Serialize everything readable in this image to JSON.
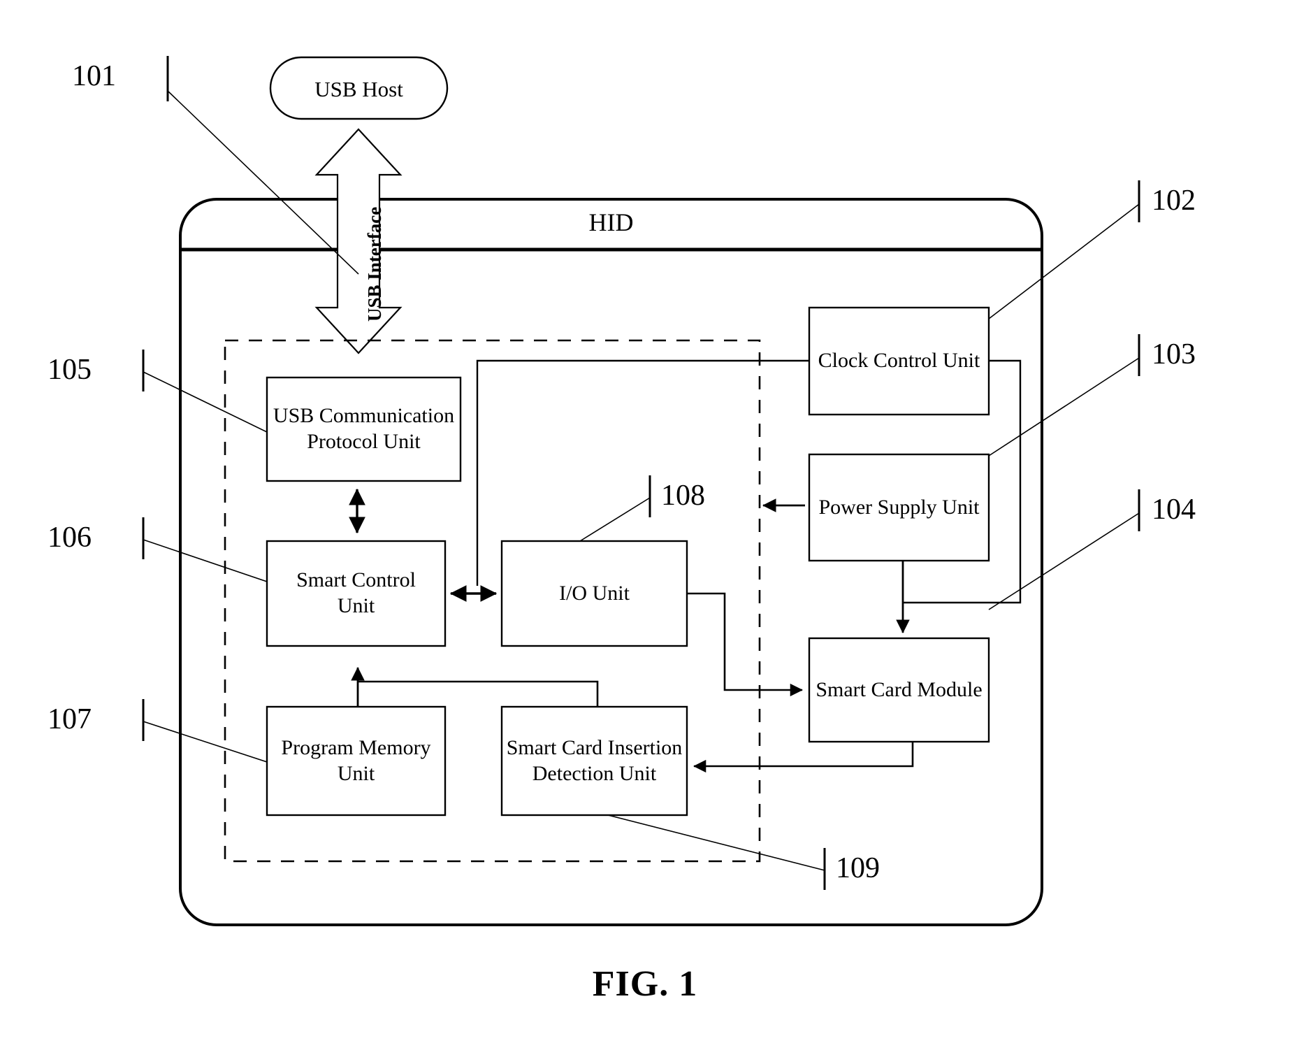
{
  "figure": {
    "caption": "FIG. 1",
    "outer_device_title": "HID",
    "usb_host_label": "USB Host",
    "usb_interface_label": "USB Interface"
  },
  "boxes": [
    {
      "id": "usb-host",
      "label": "USB Host"
    },
    {
      "id": "usb-comm",
      "label": "USB Communication\nProtocol Unit"
    },
    {
      "id": "smart-control",
      "label": "Smart Control\nUnit"
    },
    {
      "id": "io-unit",
      "label": "I/O Unit"
    },
    {
      "id": "program-memory",
      "label": "Program Memory\nUnit"
    },
    {
      "id": "card-detection",
      "label": "Smart Card Insertion\nDetection Unit"
    },
    {
      "id": "clock-control",
      "label": "Clock Control Unit"
    },
    {
      "id": "power-supply",
      "label": "Power Supply Unit"
    },
    {
      "id": "smart-card",
      "label": "Smart Card Module"
    }
  ],
  "reference_numerals": [
    {
      "id": "101",
      "label": "101",
      "points_to": "usb-host"
    },
    {
      "id": "102",
      "label": "102",
      "points_to": "clock-control"
    },
    {
      "id": "103",
      "label": "103",
      "points_to": "power-supply"
    },
    {
      "id": "104",
      "label": "104",
      "points_to": "smart-card"
    },
    {
      "id": "105",
      "label": "105",
      "points_to": "usb-comm"
    },
    {
      "id": "106",
      "label": "106",
      "points_to": "smart-control"
    },
    {
      "id": "107",
      "label": "107",
      "points_to": "program-memory"
    },
    {
      "id": "108",
      "label": "108",
      "points_to": "io-unit"
    },
    {
      "id": "109",
      "label": "109",
      "points_to": "card-detection"
    }
  ],
  "colors": {
    "line": "#000000",
    "background": "#ffffff"
  }
}
